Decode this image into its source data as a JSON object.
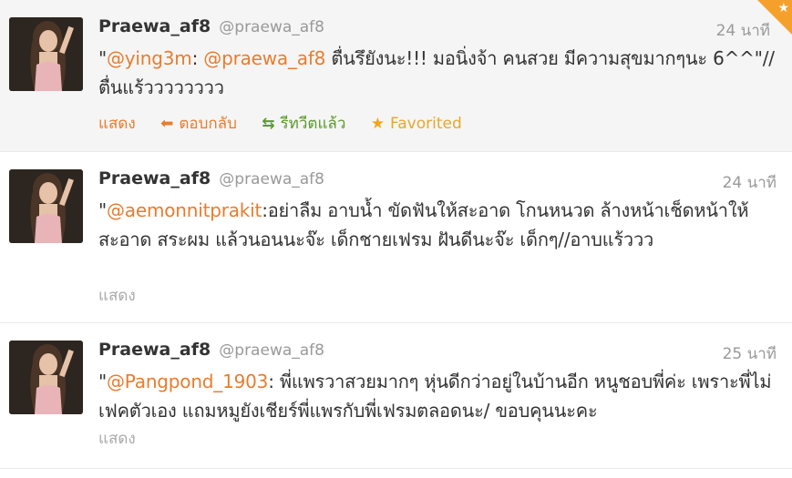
{
  "colors": {
    "accent": "#e97c2d",
    "retweet_green": "#5b9a2a",
    "favorite_gold": "#f2a51a",
    "muted": "#999999",
    "favorited_bg": "#f5f5f5"
  },
  "tweets": [
    {
      "name": "Praewa_af8",
      "handle": "@praewa_af8",
      "time": "24 นาที",
      "text": {
        "quote_open": "\"",
        "mention1": "@ying3m",
        "mid1": ": ",
        "mention2": "@praewa_af8",
        "body": " ตื่นรึยังนะ!!! มอนิ่งจ้า คนสวย มีความสุขมากๆนะ 6^^\"//ตื่นแร้วววววววว"
      },
      "actions": {
        "show": "แสดง",
        "reply": "ตอบกลับ",
        "retweeted": "รีทวีตแล้ว",
        "favorited": "Favorited"
      },
      "icons": {
        "reply": "reply-arrow-icon",
        "retweet": "retweet-icon",
        "favorite": "star-icon",
        "corner": "favorited-corner-badge"
      }
    },
    {
      "name": "Praewa_af8",
      "handle": "@praewa_af8",
      "time": "24 นาที",
      "text": {
        "quote_open": "\"",
        "mention1": "@aemonnitprakit",
        "body": ":อย่าลืม อาบน้ำ ขัดฟันให้สะอาด โกนหนวด ล้างหน้าเช็ดหน้าให้สะอาด สระผม แล้วนอนนะจ๊ะ เด็กชายเฟรม ฝันดีนะจ๊ะ เด็กๆ//อาบแร้ววว"
      },
      "actions": {
        "show": "แสดง"
      }
    },
    {
      "name": "Praewa_af8",
      "handle": "@praewa_af8",
      "time": "25 นาที",
      "text": {
        "quote_open": "\"",
        "mention1": "@Pangpond_1903",
        "body": ": พี่แพรวาสวยมากๆ หุ่นดีกว่าอยู่ในบ้านอีก หนูชอบพี่ค่ะ เพราะพี่ไม่เฟคตัวเอง แถมหมูยังเชียร์พี่แพรกับพี่เฟรมตลอดนะ/ ขอบคุนนะคะ"
      },
      "actions": {
        "show": "แสดง"
      }
    }
  ]
}
